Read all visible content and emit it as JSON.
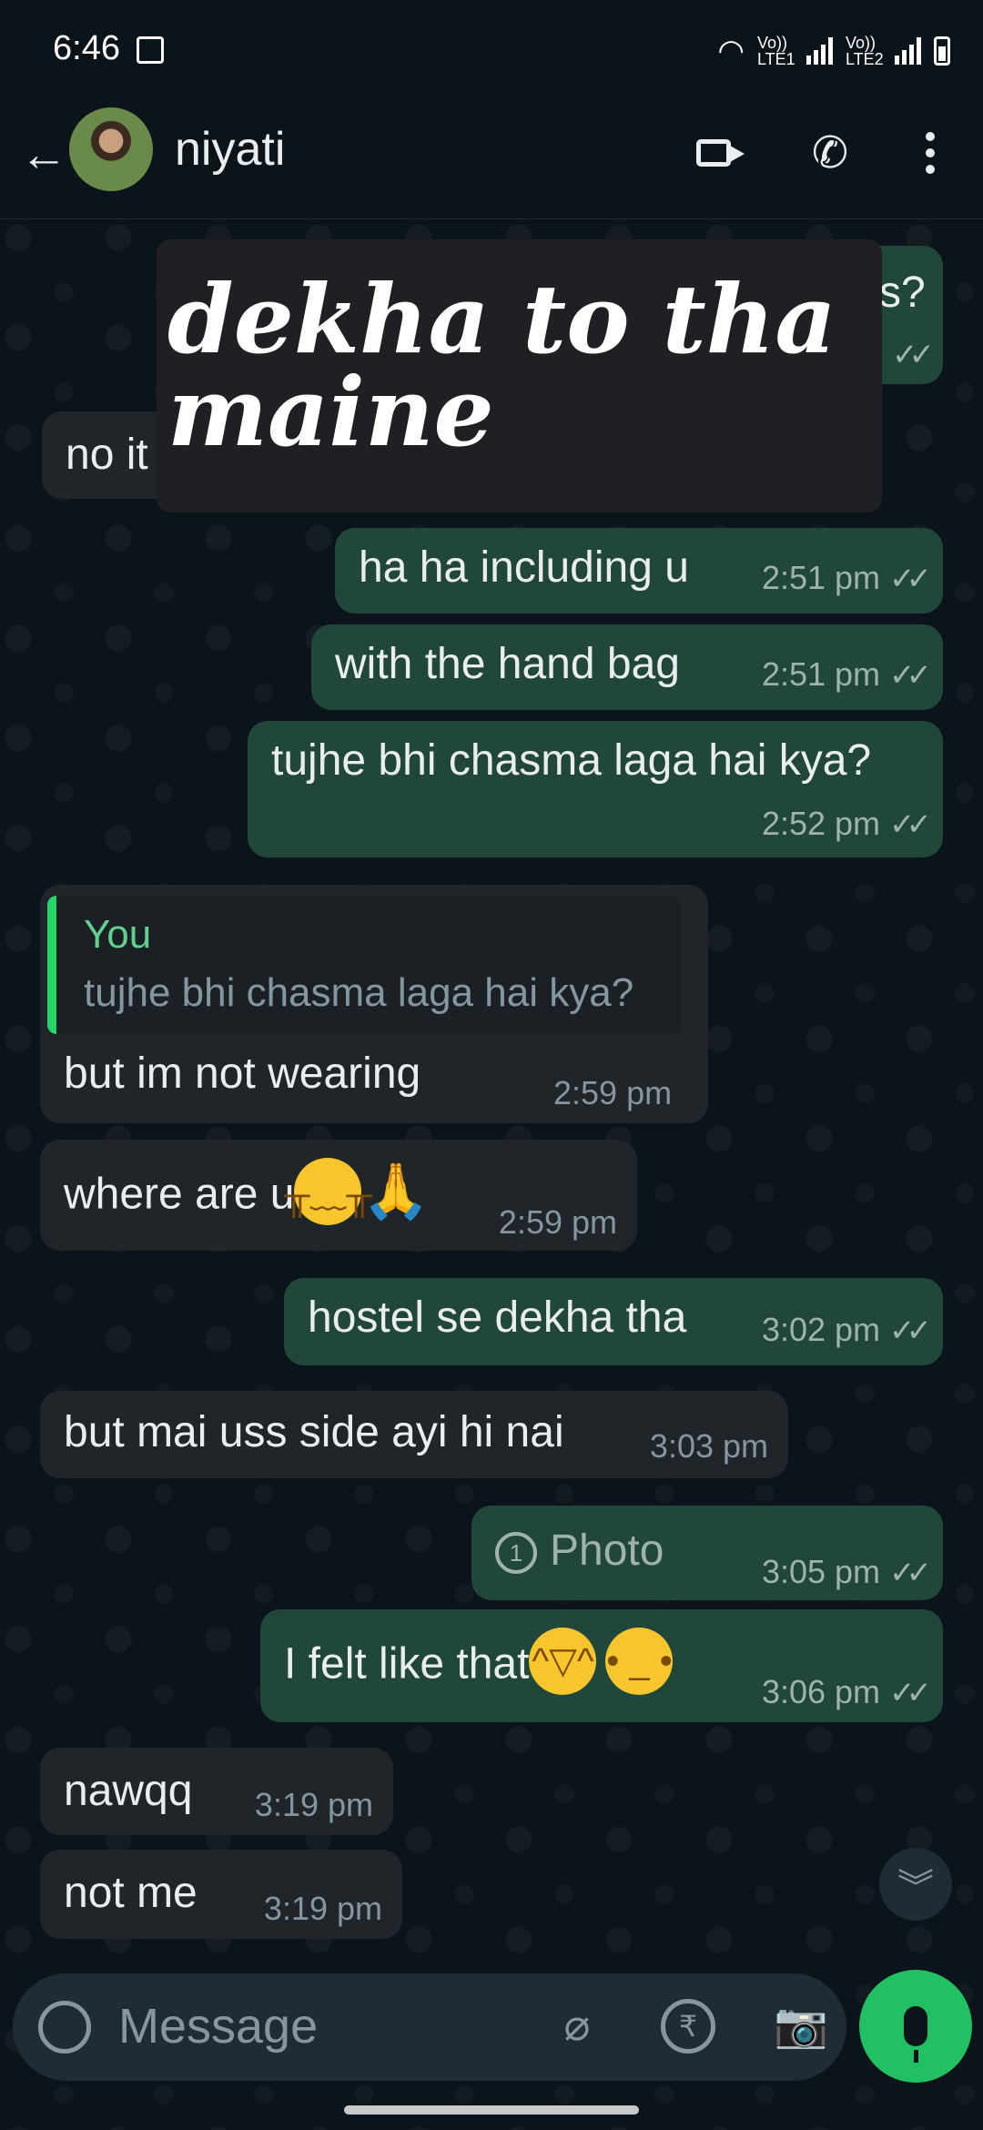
{
  "status_bar": {
    "time": "6:46",
    "sim1": "Vo)) LTE1",
    "sim2": "Vo)) LTE2"
  },
  "header": {
    "contact_name": "niyati"
  },
  "sticker": {
    "line1": "dekha to tha",
    "line2": "maine"
  },
  "partial": {
    "out_suffix": "s?",
    "in_prefix": "no it"
  },
  "messages": [
    {
      "id": "m1",
      "dir": "out",
      "text": "ha ha including u",
      "time": "2:51 pm",
      "ticks": "✓✓"
    },
    {
      "id": "m2",
      "dir": "out",
      "text": "with the hand bag",
      "time": "2:51 pm",
      "ticks": "✓✓"
    },
    {
      "id": "m3",
      "dir": "out",
      "text": "tujhe bhi chasma laga hai kya?",
      "time": "2:52 pm",
      "ticks": "✓✓"
    },
    {
      "id": "m4",
      "dir": "in",
      "text": "but im not wearing",
      "time": "2:59 pm",
      "quote": {
        "author": "You",
        "text": "tujhe bhi chasma laga hai kya?"
      }
    },
    {
      "id": "m5",
      "dir": "in",
      "text": "where are u",
      "time": "2:59 pm",
      "emojis": [
        "crying-face",
        "folded-hands"
      ]
    },
    {
      "id": "m6",
      "dir": "out",
      "text": "hostel se dekha tha",
      "time": "3:02 pm",
      "ticks": "✓✓"
    },
    {
      "id": "m7",
      "dir": "in",
      "text": "but mai uss side ayi hi nai",
      "time": "3:03 pm"
    },
    {
      "id": "m8",
      "dir": "out",
      "text": "Photo",
      "time": "3:05 pm",
      "ticks": "✓✓",
      "view_once_icon": "1"
    },
    {
      "id": "m9",
      "dir": "out",
      "text": "I felt like that",
      "time": "3:06 pm",
      "ticks": "✓✓",
      "emojis": [
        "grinning-sweat",
        "neutral-face"
      ]
    },
    {
      "id": "m10",
      "dir": "in",
      "text": "nawqq",
      "time": "3:19 pm"
    },
    {
      "id": "m11",
      "dir": "in",
      "text": "not me",
      "time": "3:19 pm"
    }
  ],
  "composer": {
    "placeholder": "Message",
    "rupee_symbol": "₹"
  },
  "colors": {
    "outgoing": "#21463a",
    "incoming": "#1f2529",
    "accent": "#21c063",
    "background": "#0b141a"
  }
}
